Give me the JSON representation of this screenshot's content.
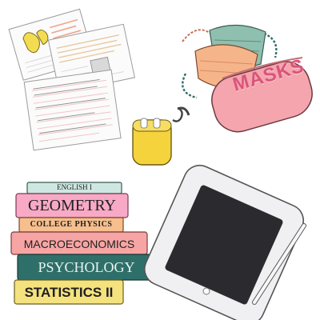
{
  "scene": {
    "books": [
      {
        "title": "ENGLISH I",
        "color": "#cfe7e1",
        "spine": "#6ea79a"
      },
      {
        "title": "GEOMETRY",
        "color": "#f7a9c6",
        "spine": "#c86d92"
      },
      {
        "title": "COLLEGE PHYSICS",
        "color": "#f7bf8e",
        "spine": "#c7864f"
      },
      {
        "title": "MACROECONOMICS",
        "color": "#f6a5a4",
        "spine": "#c76d6e"
      },
      {
        "title": "PSYCHOLOGY",
        "color": "#2f6f6a",
        "spine": "#1f4b47"
      },
      {
        "title": "STATISTICS II",
        "color": "#f4e27e",
        "spine": "#c6b356"
      }
    ],
    "pouch_label": "MASKS",
    "colors": {
      "paper": "#fbfbfb",
      "paper_line": "#f2c6c6",
      "yellow": "#f5d33c",
      "mask_teal": "#8fbfae",
      "mask_orange": "#f6b48a",
      "pouch": "#f4a5ad",
      "tablet_frame": "#f0f0f2",
      "tablet_screen": "#2b2b2f"
    }
  }
}
